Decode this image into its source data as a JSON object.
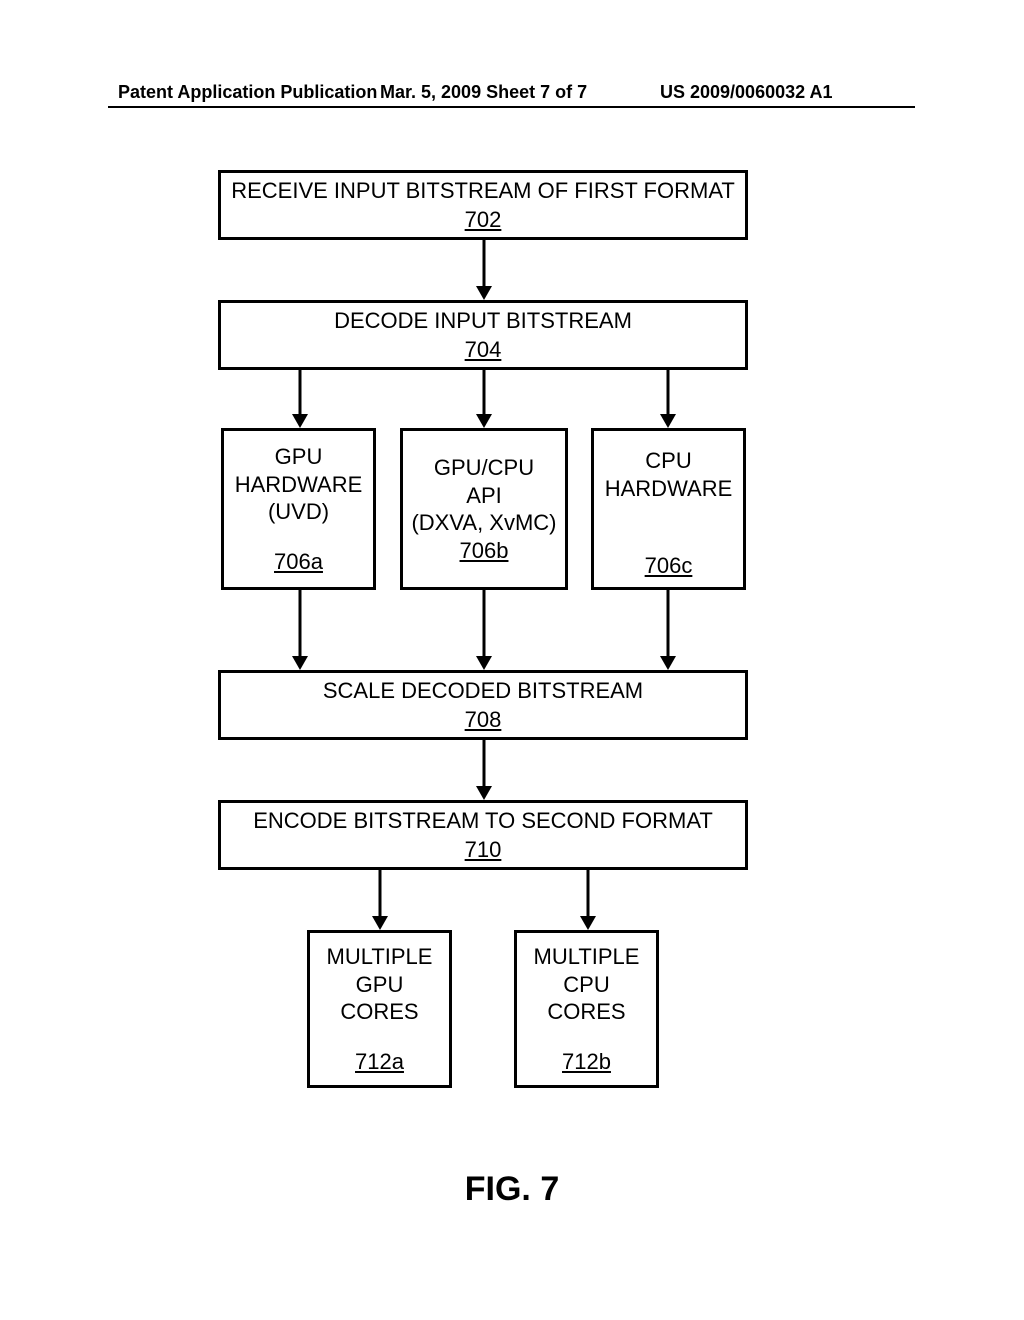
{
  "header": {
    "left": "Patent Application Publication",
    "center": "Mar. 5, 2009  Sheet 7 of 7",
    "right": "US 2009/0060032 A1"
  },
  "boxes": {
    "b702": {
      "line1": "RECEIVE INPUT BITSTREAM OF FIRST FORMAT",
      "ref": "702"
    },
    "b704": {
      "line1": "DECODE INPUT BITSTREAM",
      "ref": "704"
    },
    "b706a": {
      "l1": "GPU",
      "l2": "HARDWARE",
      "l3": "(UVD)",
      "ref": "706a"
    },
    "b706b": {
      "l1": "GPU/CPU",
      "l2": "API",
      "l3": "(DXVA, XvMC)",
      "ref": "706b"
    },
    "b706c": {
      "l1": "CPU",
      "l2": "HARDWARE",
      "ref": "706c"
    },
    "b708": {
      "line1": "SCALE DECODED BITSTREAM",
      "ref": "708"
    },
    "b710": {
      "line1": "ENCODE BITSTREAM TO SECOND FORMAT",
      "ref": "710"
    },
    "b712a": {
      "l1": "MULTIPLE",
      "l2": "GPU",
      "l3": "CORES",
      "ref": "712a"
    },
    "b712b": {
      "l1": "MULTIPLE",
      "l2": "CPU",
      "l3": "CORES",
      "ref": "712b"
    }
  },
  "figure_label": "FIG. 7"
}
